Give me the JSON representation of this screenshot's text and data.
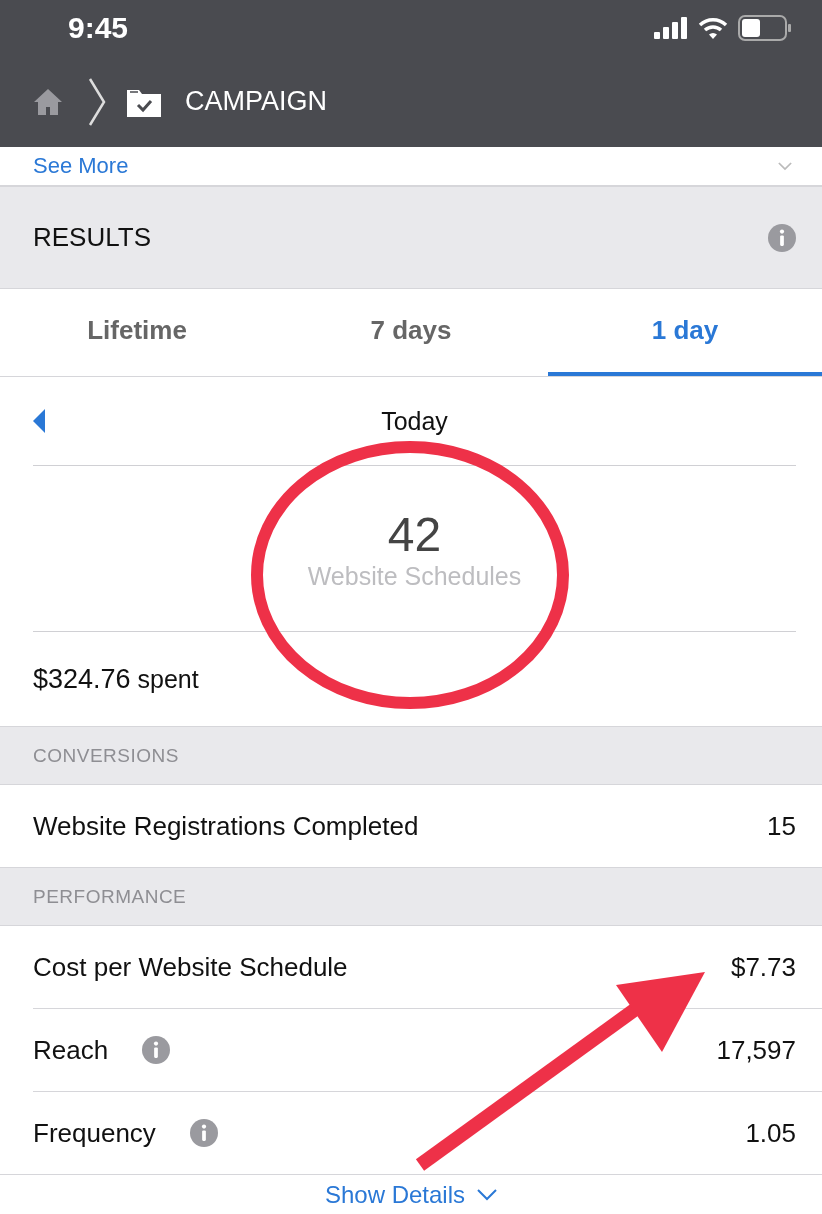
{
  "status_bar": {
    "time": "9:45"
  },
  "nav": {
    "title": "CAMPAIGN"
  },
  "see_more": {
    "label": "See More"
  },
  "results": {
    "title": "RESULTS"
  },
  "tabs": [
    {
      "label": "Lifetime",
      "selected": false
    },
    {
      "label": "7 days",
      "selected": false
    },
    {
      "label": "1 day",
      "selected": true
    }
  ],
  "date_nav": {
    "label": "Today"
  },
  "headline": {
    "value": "42",
    "label": "Website Schedules"
  },
  "spent": {
    "amount": "$324.76",
    "label": "spent"
  },
  "sections": [
    {
      "title": "CONVERSIONS",
      "rows": [
        {
          "label": "Website Registrations Completed",
          "value": "15",
          "info": false
        }
      ]
    },
    {
      "title": "PERFORMANCE",
      "rows": [
        {
          "label": "Cost per Website Schedule",
          "value": "$7.73",
          "info": false
        },
        {
          "label": "Reach",
          "value": "17,597",
          "info": true
        },
        {
          "label": "Frequency",
          "value": "1.05",
          "info": true
        }
      ]
    }
  ],
  "show_details": {
    "label": "Show Details"
  }
}
